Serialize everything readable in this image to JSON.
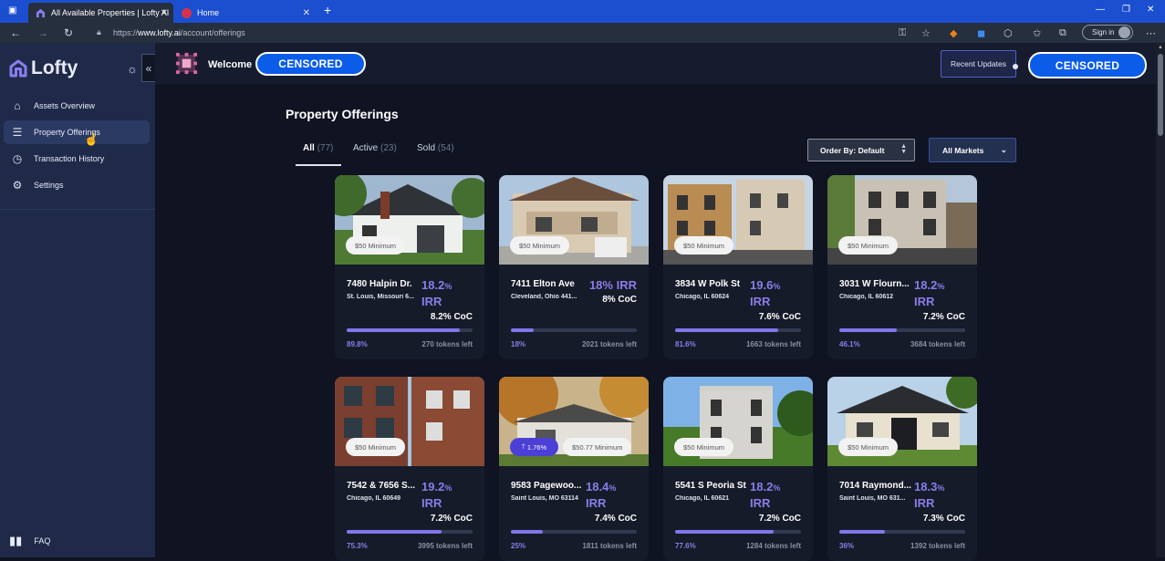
{
  "browser": {
    "tabs": [
      {
        "label": "All Available Properties | Lofty AI"
      },
      {
        "label": "Home"
      }
    ],
    "url_prefix": "https://",
    "url_host": "www.lofty.ai",
    "url_path": "/account/offerings",
    "signin_label": "Sign in"
  },
  "sidebar": {
    "logo_text": "Lofty",
    "items": [
      {
        "label": "Assets Overview",
        "icon": "home-icon"
      },
      {
        "label": "Property Offerings",
        "icon": "coins-icon"
      },
      {
        "label": "Transaction History",
        "icon": "clock-icon"
      },
      {
        "label": "Settings",
        "icon": "gears-icon"
      }
    ],
    "faq_label": "FAQ"
  },
  "topbar": {
    "welcome": "Welcome",
    "censored_left": "CENSORED",
    "censored_right": "CENSORED",
    "recent_updates": "Recent Updates"
  },
  "main": {
    "title": "Property Offerings",
    "filter_tabs": [
      {
        "label": "All",
        "count": "(77)"
      },
      {
        "label": "Active",
        "count": "(23)"
      },
      {
        "label": "Sold",
        "count": "(54)"
      }
    ],
    "order_by_label": "Order By:",
    "order_by_value": "Default",
    "markets_label": "All Markets"
  },
  "colors": {
    "accent": "#8376ea",
    "sidebar_bg": "#1f2a49",
    "page_bg": "#0f1322",
    "censor_blue": "#0b5ce8"
  },
  "properties": [
    {
      "address": "7480 Halpin Dr.",
      "city": "St. Louis, Missouri 6...",
      "irr_num": "18.2",
      "irr_pct": "%",
      "irr_label": "IRR",
      "coc": "8.2% CoC",
      "progress": 0.898,
      "pct_label": "89.8%",
      "tokens_left": "270 tokens left",
      "minimum": "$50 Minimum"
    },
    {
      "address": "7411 Elton Ave",
      "city": "Cleveland, Ohio 441...",
      "irr_num": "18",
      "irr_pct": "%",
      "irr_label": "IRR",
      "coc": "8% CoC",
      "progress": 0.18,
      "pct_label": "18%",
      "tokens_left": "2021 tokens left",
      "minimum": "$50 Minimum"
    },
    {
      "address": "3834 W Polk St",
      "city": "Chicago, IL 60624",
      "irr_num": "19.6",
      "irr_pct": "%",
      "irr_label": "IRR",
      "coc": "7.6% CoC",
      "progress": 0.816,
      "pct_label": "81.6%",
      "tokens_left": "1663 tokens left",
      "minimum": "$50 Minimum"
    },
    {
      "address": "3031 W Flourn...",
      "city": "Chicago, IL 60612",
      "irr_num": "18.2",
      "irr_pct": "%",
      "irr_label": "IRR",
      "coc": "7.2% CoC",
      "progress": 0.461,
      "pct_label": "46.1%",
      "tokens_left": "3684 tokens left",
      "minimum": "$50 Minimum"
    },
    {
      "address": "7542 & 7656 S...",
      "city": "Chicago, IL 60649",
      "irr_num": "19.2",
      "irr_pct": "%",
      "irr_label": "IRR",
      "coc": "7.2% CoC",
      "progress": 0.753,
      "pct_label": "75.3%",
      "tokens_left": "3995 tokens left",
      "minimum": "$50 Minimum"
    },
    {
      "address": "9583 Pagewoo...",
      "city": "Saint Louis, MO 63114",
      "irr_num": "18.4",
      "irr_pct": "%",
      "irr_label": "IRR",
      "coc": "7.4% CoC",
      "progress": 0.25,
      "pct_label": "25%",
      "tokens_left": "1811 tokens left",
      "minimum": "$50.77 Minimum",
      "appreciation": "1.76%"
    },
    {
      "address": "5541 S Peoria St",
      "city": "Chicago, IL 60621",
      "irr_num": "18.2",
      "irr_pct": "%",
      "irr_label": "IRR",
      "coc": "7.2% CoC",
      "progress": 0.776,
      "pct_label": "77.6%",
      "tokens_left": "1284 tokens left",
      "minimum": "$50 Minimum"
    },
    {
      "address": "7014 Raymond...",
      "city": "Saint Louis, MO 631...",
      "irr_num": "18.3",
      "irr_pct": "%",
      "irr_label": "IRR",
      "coc": "7.3% CoC",
      "progress": 0.36,
      "pct_label": "36%",
      "tokens_left": "1392 tokens left",
      "minimum": "$50 Minimum"
    }
  ]
}
